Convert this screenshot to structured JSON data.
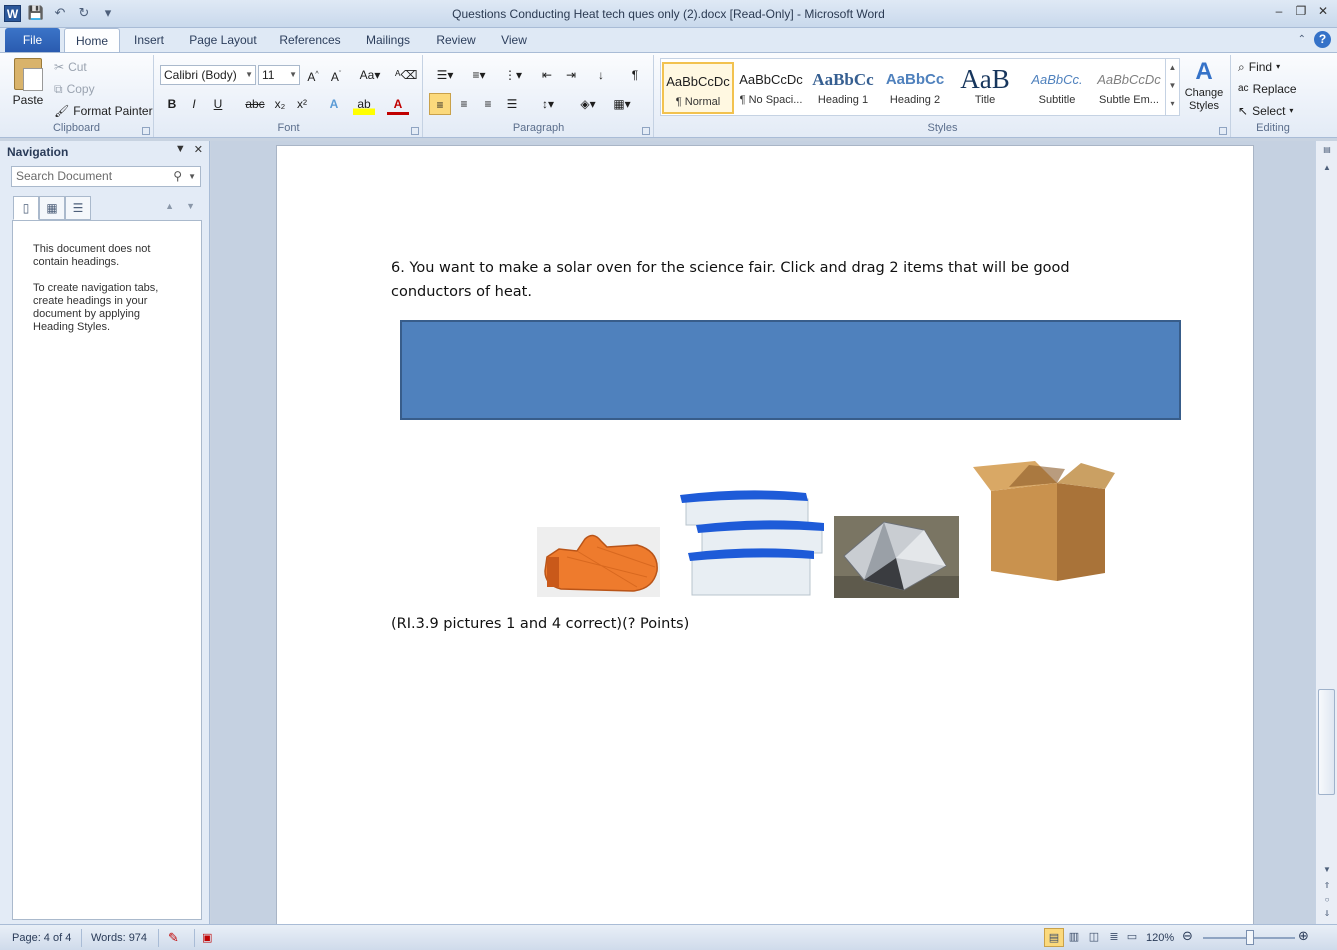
{
  "window": {
    "title": "Questions Conducting Heat tech ques only (2).docx [Read-Only]  -  Microsoft Word",
    "app_icon_letter": "W"
  },
  "tabs": {
    "file": "File",
    "items": [
      "Home",
      "Insert",
      "Page Layout",
      "References",
      "Mailings",
      "Review",
      "View"
    ],
    "active": "Home"
  },
  "ribbon": {
    "clipboard": {
      "label": "Clipboard",
      "paste": "Paste",
      "cut": "Cut",
      "copy": "Copy",
      "format_painter": "Format Painter"
    },
    "font": {
      "label": "Font",
      "family": "Calibri (Body)",
      "size": "11",
      "bold": "B",
      "italic": "I",
      "underline": "U",
      "strike": "abc",
      "subscript": "x₂",
      "superscript": "x²",
      "change_case": "Aa"
    },
    "paragraph": {
      "label": "Paragraph"
    },
    "styles": {
      "label": "Styles",
      "items": [
        {
          "preview": "AaBbCcDc",
          "name": "¶ Normal"
        },
        {
          "preview": "AaBbCcDc",
          "name": "¶ No Spaci..."
        },
        {
          "preview": "AaBbCc",
          "name": "Heading 1"
        },
        {
          "preview": "AaBbCc",
          "name": "Heading 2"
        },
        {
          "preview": "AaB",
          "name": "Title"
        },
        {
          "preview": "AaBbCc.",
          "name": "Subtitle"
        },
        {
          "preview": "AaBbCcDc",
          "name": "Subtle Em..."
        }
      ],
      "change_styles": "Change Styles"
    },
    "editing": {
      "label": "Editing",
      "find": "Find",
      "replace": "Replace",
      "select": "Select"
    }
  },
  "navigation": {
    "title": "Navigation",
    "search_placeholder": "Search Document",
    "message_1": "This document does not contain headings.",
    "message_2": "To create navigation tabs, create headings in your document by applying Heading Styles."
  },
  "document": {
    "question": "6.  You want to make a solar oven for the science fair. Click and drag 2 items that will be good conductors of heat.",
    "reference": "(RI.3.9 pictures 1 and 4 correct)(? Points)",
    "drop_box_color": "#4f81bd"
  },
  "status": {
    "page": "Page: 4 of 4",
    "words": "Words: 974",
    "zoom": "120%"
  }
}
